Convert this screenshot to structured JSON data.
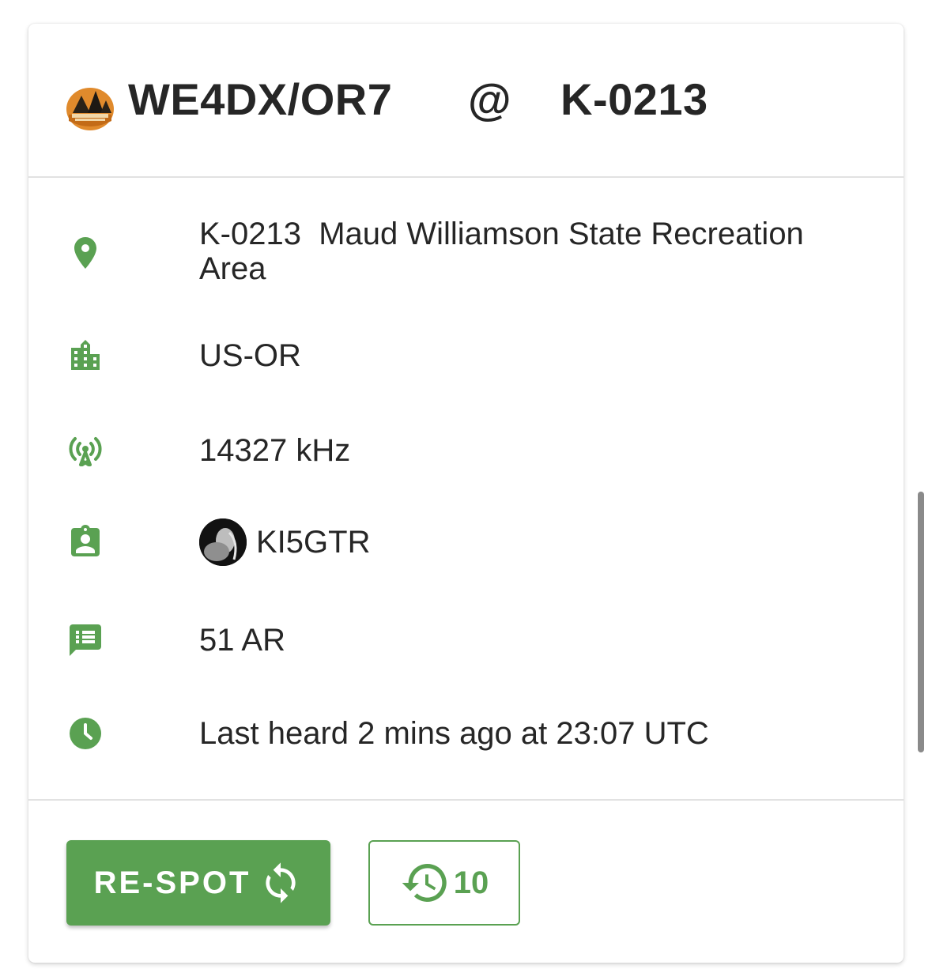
{
  "header": {
    "activator": "WE4DX/OR7",
    "at": "@",
    "reference": "K-0213"
  },
  "details": {
    "location": "K-0213  Maud Williamson State Recreation Area",
    "region": "US-OR",
    "frequency": "14327 kHz",
    "spotter": "KI5GTR",
    "comment": "51 AR",
    "last_heard": "Last heard 2 mins ago at 23:07 UTC"
  },
  "icons": {
    "location": "map-pin-icon",
    "region": "city-icon",
    "frequency": "antenna-icon",
    "spotter": "badge-icon",
    "comment": "comment-icon",
    "time": "clock-icon"
  },
  "actions": {
    "respot_label": "RE-SPOT",
    "history_count": "10"
  },
  "colors": {
    "accent": "#5aa152",
    "text": "#262626"
  }
}
